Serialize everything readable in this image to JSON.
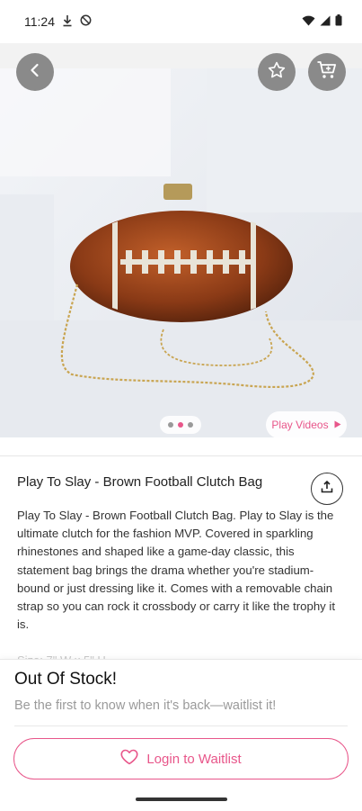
{
  "status_bar": {
    "time": "11:24",
    "left_icons": [
      "download-icon",
      "dnd-icon"
    ],
    "right_icons": [
      "wifi-icon",
      "signal-icon",
      "battery-icon"
    ]
  },
  "header": {
    "icons": [
      "back-arrow-icon",
      "star-icon",
      "cart-icon"
    ]
  },
  "gallery": {
    "dot_count": 3,
    "active_dot": 2,
    "play_videos_label": "Play Videos"
  },
  "product": {
    "title": "Play To Slay - Brown Football Clutch Bag",
    "description": "Play To Slay - Brown Football Clutch Bag. Play to Slay is the ultimate clutch for the fashion MVP. Covered in sparkling rhinestones and shaped like a game-day classic, this statement bag brings the drama whether you're stadium-bound or just dressing like it. Comes with a removable chain strap so you can rock it crossbody or carry it like the trophy it is.",
    "next_line_partial": "Size: 7\" W x 5\" H"
  },
  "stock_sheet": {
    "title": "Out Of Stock!",
    "subtitle": "Be the first to know when it's back—waitlist it!",
    "button_label": "Login to Waitlist"
  },
  "colors": {
    "accent": "#e8568a",
    "icon_button_bg": "#8a8a8a"
  }
}
